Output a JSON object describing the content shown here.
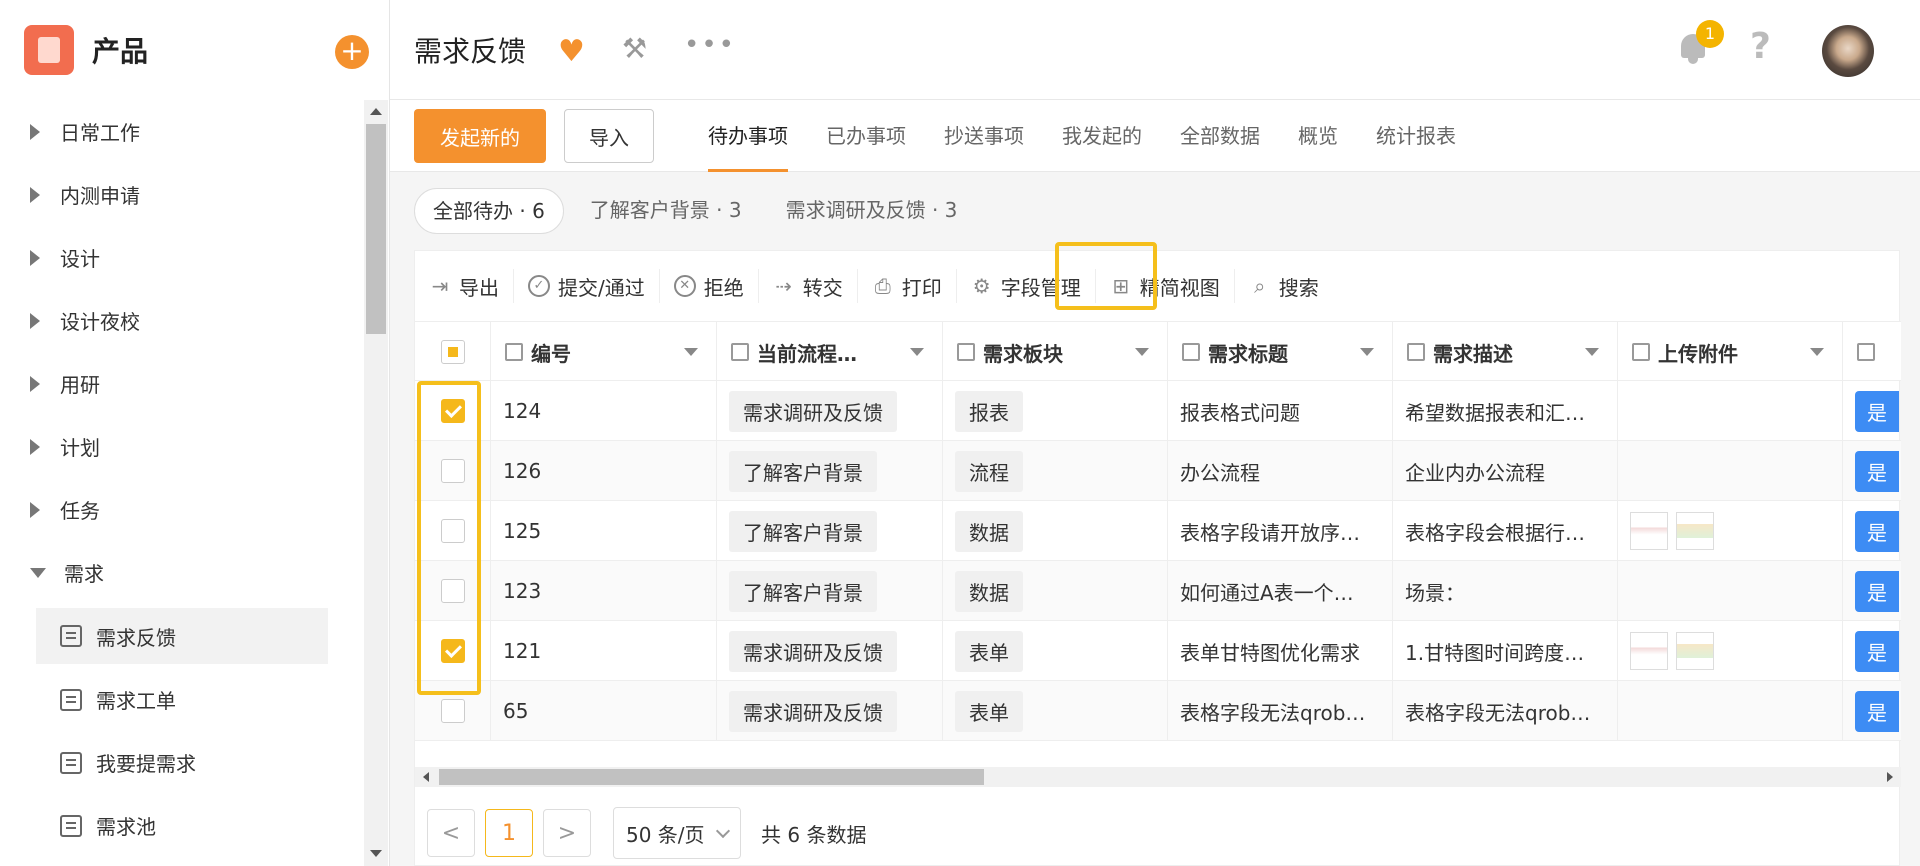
{
  "app": {
    "name": "产品",
    "add_icon": "plus-icon"
  },
  "sidebar": {
    "items": [
      {
        "label": "日常工作"
      },
      {
        "label": "内测申请"
      },
      {
        "label": "设计"
      },
      {
        "label": "设计夜校"
      },
      {
        "label": "用研"
      },
      {
        "label": "计划"
      },
      {
        "label": "任务"
      },
      {
        "label": "需求"
      }
    ],
    "sub_items": [
      {
        "label": "需求反馈",
        "active": true
      },
      {
        "label": "需求工单"
      },
      {
        "label": "我要提需求"
      },
      {
        "label": "需求池"
      }
    ]
  },
  "header": {
    "title": "需求反馈",
    "notification_count": "1",
    "help": "?"
  },
  "toolbar": {
    "new_label": "发起新的",
    "import_label": "导入",
    "tabs": [
      "待办事项",
      "已办事项",
      "抄送事项",
      "我发起的",
      "全部数据",
      "概览",
      "统计报表"
    ],
    "active_tab": "待办事项"
  },
  "filters": [
    "全部待办 · 6",
    "了解客户背景 · 3",
    "需求调研及反馈 · 3"
  ],
  "ops": [
    "导出",
    "提交/通过",
    "拒绝",
    "转交",
    "打印",
    "字段管理",
    "精简视图",
    "搜索"
  ],
  "table": {
    "columns": [
      "编号",
      "当前流程…",
      "需求板块",
      "需求标题",
      "需求描述",
      "上传附件"
    ],
    "rows": [
      {
        "checked": true,
        "id": "124",
        "flow": "需求调研及反馈",
        "block": "报表",
        "title": "报表格式问题",
        "desc": "希望数据报表和汇…",
        "attach": false,
        "yes": "是"
      },
      {
        "checked": false,
        "id": "126",
        "flow": "了解客户背景",
        "block": "流程",
        "title": "办公流程",
        "desc": "企业内办公流程",
        "attach": false,
        "yes": "是"
      },
      {
        "checked": false,
        "id": "125",
        "flow": "了解客户背景",
        "block": "数据",
        "title": "表格字段请开放序…",
        "desc": "表格字段会根据行…",
        "attach": true,
        "yes": "是"
      },
      {
        "checked": false,
        "id": "123",
        "flow": "了解客户背景",
        "block": "数据",
        "title": "如何通过A表一个…",
        "desc": "场景：",
        "attach": false,
        "yes": "是"
      },
      {
        "checked": true,
        "id": "121",
        "flow": "需求调研及反馈",
        "block": "表单",
        "title": "表单甘特图优化需求",
        "desc": "1.甘特图时间跨度…",
        "attach": true,
        "yes": "是"
      },
      {
        "checked": false,
        "id": "65",
        "flow": "需求调研及反馈",
        "block": "表单",
        "title": "表格字段无法qrob…",
        "desc": "表格字段无法qrob…",
        "attach": false,
        "yes": "是"
      }
    ]
  },
  "pager": {
    "current": "1",
    "page_size": "50 条/页",
    "total": "共 6 条数据",
    "prev": "<",
    "next": ">"
  }
}
